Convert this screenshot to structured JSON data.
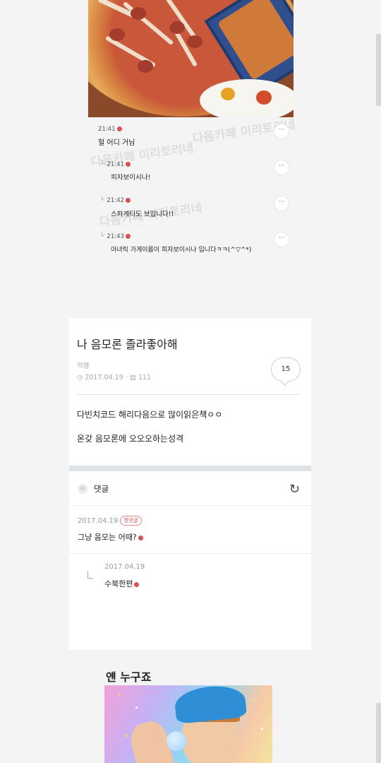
{
  "top_capture": {
    "watermark": "다음카페 미리토리네",
    "comments": [
      {
        "time": "21:41",
        "text": "헐 어디 거님",
        "reply": false
      },
      {
        "time": "21:41",
        "text": "피자보이시나!",
        "reply": true
      },
      {
        "time": "21:42",
        "text": "스파게티도 보입니다!!",
        "reply": true
      },
      {
        "time": "21:43",
        "text": "아녀릭 가게이름이 피자보이시나 입니다ㅋㅋ(^▽^*)",
        "reply": true
      }
    ],
    "more_label": "···"
  },
  "post": {
    "title": "나 음모론 졸라좋아해",
    "author": "익명",
    "date": "2017.04.19",
    "separator": "·",
    "views": "111",
    "comment_count": "15",
    "body": [
      "다빈치코드 해리다음으로 많이읽은책ㅇㅇ",
      "온갖 음모론에 오오오하는성격"
    ],
    "comments_label": "댓글",
    "comments": [
      {
        "date": "2017.04.19",
        "badge": "첫댓글",
        "text": "그냥 음모는 어때?"
      },
      {
        "date": "2017.04.19",
        "text": "수북한편",
        "reply": true
      }
    ]
  },
  "bottom": {
    "title": "얜 누구죠"
  },
  "colors": {
    "new_badge": "#d8504f",
    "divider": "#dfe3e8"
  }
}
